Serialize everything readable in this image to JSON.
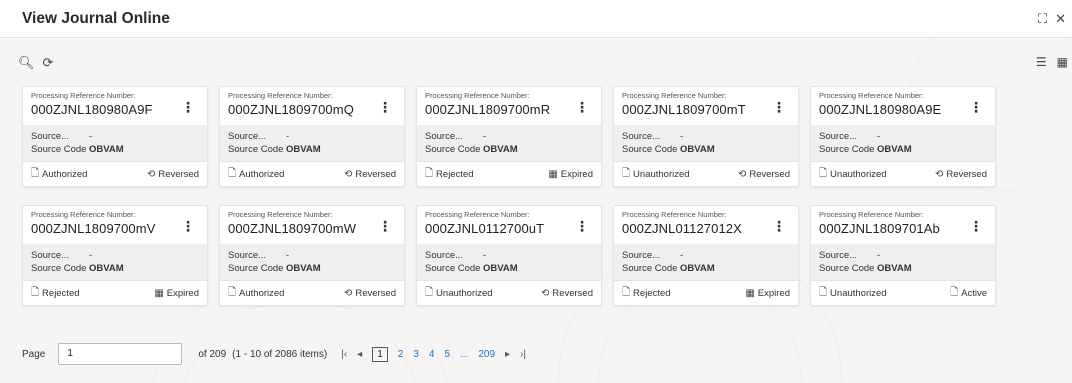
{
  "header": {
    "title": "View Journal Online"
  },
  "cards": [
    {
      "label": "Processing Reference Number:",
      "ref": "000ZJNL180980A9F",
      "k1": "Source...",
      "v1": "-",
      "k2": "Source Code",
      "v2": "OBVAM",
      "left_status": "Authorized",
      "right_status": "Reversed",
      "left_icon": "document-icon",
      "right_icon": "reverse-icon"
    },
    {
      "label": "Processing Reference Number:",
      "ref": "000ZJNL1809700mQ",
      "k1": "Source...",
      "v1": "-",
      "k2": "Source Code",
      "v2": "OBVAM",
      "left_status": "Authorized",
      "right_status": "Reversed",
      "left_icon": "document-icon",
      "right_icon": "reverse-icon"
    },
    {
      "label": "Processing Reference Number:",
      "ref": "000ZJNL1809700mR",
      "k1": "Source...",
      "v1": "-",
      "k2": "Source Code",
      "v2": "OBVAM",
      "left_status": "Rejected",
      "right_status": "Expired",
      "left_icon": "rejected-document-icon",
      "right_icon": "calendar-icon"
    },
    {
      "label": "Processing Reference Number:",
      "ref": "000ZJNL1809700mT",
      "k1": "Source...",
      "v1": "-",
      "k2": "Source Code",
      "v2": "OBVAM",
      "left_status": "Unauthorized",
      "right_status": "Reversed",
      "left_icon": "document-icon",
      "right_icon": "reverse-icon"
    },
    {
      "label": "Processing Reference Number:",
      "ref": "000ZJNL180980A9E",
      "k1": "Source...",
      "v1": "-",
      "k2": "Source Code",
      "v2": "OBVAM",
      "left_status": "Unauthorized",
      "right_status": "Reversed",
      "left_icon": "document-icon",
      "right_icon": "reverse-icon"
    },
    {
      "label": "Processing Reference Number:",
      "ref": "000ZJNL1809700mV",
      "k1": "Source...",
      "v1": "-",
      "k2": "Source Code",
      "v2": "OBVAM",
      "left_status": "Rejected",
      "right_status": "Expired",
      "left_icon": "rejected-document-icon",
      "right_icon": "calendar-icon"
    },
    {
      "label": "Processing Reference Number:",
      "ref": "000ZJNL1809700mW",
      "k1": "Source...",
      "v1": "-",
      "k2": "Source Code",
      "v2": "OBVAM",
      "left_status": "Authorized",
      "right_status": "Reversed",
      "left_icon": "document-icon",
      "right_icon": "reverse-icon"
    },
    {
      "label": "Processing Reference Number:",
      "ref": "000ZJNL0112700uT",
      "k1": "Source...",
      "v1": "-",
      "k2": "Source Code",
      "v2": "OBVAM",
      "left_status": "Unauthorized",
      "right_status": "Reversed",
      "left_icon": "document-icon",
      "right_icon": "reverse-icon"
    },
    {
      "label": "Processing Reference Number:",
      "ref": "000ZJNL01127012X",
      "k1": "Source...",
      "v1": "-",
      "k2": "Source Code",
      "v2": "OBVAM",
      "left_status": "Rejected",
      "right_status": "Expired",
      "left_icon": "rejected-document-icon",
      "right_icon": "calendar-icon"
    },
    {
      "label": "Processing Reference Number:",
      "ref": "000ZJNL1809701Ab",
      "k1": "Source...",
      "v1": "-",
      "k2": "Source Code",
      "v2": "OBVAM",
      "left_status": "Unauthorized",
      "right_status": "Active",
      "left_icon": "document-icon",
      "right_icon": "active-document-icon"
    }
  ],
  "pager": {
    "page_label": "Page",
    "page_value": "1",
    "of_text": "of 209",
    "range_text": "(1 - 10 of 2086 items)",
    "pages": [
      "1",
      "2",
      "3",
      "4",
      "5",
      "...",
      "209"
    ]
  },
  "colors": {
    "link": "#1f72c8",
    "text": "#2b2b2b"
  }
}
